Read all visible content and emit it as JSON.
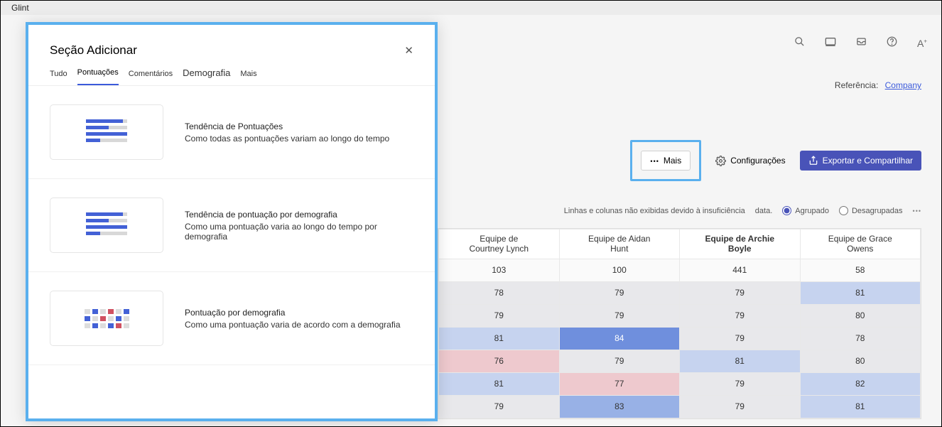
{
  "app": {
    "title": "Glint"
  },
  "header": {
    "reference_label": "Referência:",
    "reference_link": "Company"
  },
  "toolbar": {
    "more_label": "Mais",
    "settings_label": "Configurações",
    "export_label": "Exportar e Compartilhar"
  },
  "table_controls": {
    "note_left": "Linhas e colunas não exibidas devido à insuficiência",
    "note_right": "data.",
    "grouped": "Agrupado",
    "ungrouped": "Desagrupadas"
  },
  "table": {
    "headers": [
      {
        "line1": "Equipe de",
        "line2": "Courtney Lynch",
        "bold": false
      },
      {
        "line1": "Equipe de Aidan",
        "line2": "Hunt",
        "bold": false
      },
      {
        "line1": "Equipe de Archie",
        "line2": "Boyle",
        "bold": true
      },
      {
        "line1": "Equipe de Grace",
        "line2": "Owens",
        "bold": false
      }
    ],
    "rows": [
      [
        {
          "v": "103",
          "c": "c-white"
        },
        {
          "v": "100",
          "c": "c-white"
        },
        {
          "v": "441",
          "c": "c-white"
        },
        {
          "v": "58",
          "c": "c-white"
        }
      ],
      [
        {
          "v": "78",
          "c": "c-l"
        },
        {
          "v": "79",
          "c": "c-l"
        },
        {
          "v": "79",
          "c": "c-l"
        },
        {
          "v": "81",
          "c": "c-b1"
        }
      ],
      [
        {
          "v": "79",
          "c": "c-l"
        },
        {
          "v": "79",
          "c": "c-l"
        },
        {
          "v": "79",
          "c": "c-l"
        },
        {
          "v": "80",
          "c": "c-l"
        }
      ],
      [
        {
          "v": "81",
          "c": "c-b1"
        },
        {
          "v": "84",
          "c": "c-b3"
        },
        {
          "v": "79",
          "c": "c-l"
        },
        {
          "v": "78",
          "c": "c-l"
        }
      ],
      [
        {
          "v": "76",
          "c": "c-r1"
        },
        {
          "v": "79",
          "c": "c-l"
        },
        {
          "v": "81",
          "c": "c-b1"
        },
        {
          "v": "80",
          "c": "c-l"
        }
      ],
      [
        {
          "v": "81",
          "c": "c-b1"
        },
        {
          "v": "77",
          "c": "c-r1"
        },
        {
          "v": "79",
          "c": "c-l"
        },
        {
          "v": "82",
          "c": "c-b1"
        }
      ],
      [
        {
          "v": "79",
          "c": "c-l"
        },
        {
          "v": "83",
          "c": "c-b2"
        },
        {
          "v": "79",
          "c": "c-l"
        },
        {
          "v": "81",
          "c": "c-b1"
        }
      ]
    ]
  },
  "modal": {
    "title": "Seção Adicionar",
    "tabs": {
      "all": "Tudo",
      "scores": "Pontuações",
      "comments": "Comentários",
      "demography": "Demografia",
      "more": "Mais"
    },
    "items": [
      {
        "title": "Tendência de Pontuações",
        "subtitle": "Como todas as pontuações variam ao longo do tempo"
      },
      {
        "title": "Tendência de pontuação por demografia",
        "subtitle": "Como uma pontuação varia ao longo do tempo por demografia"
      },
      {
        "title": "Pontuação por demografia",
        "subtitle": "Como uma pontuação varia de acordo com a demografia"
      }
    ]
  }
}
